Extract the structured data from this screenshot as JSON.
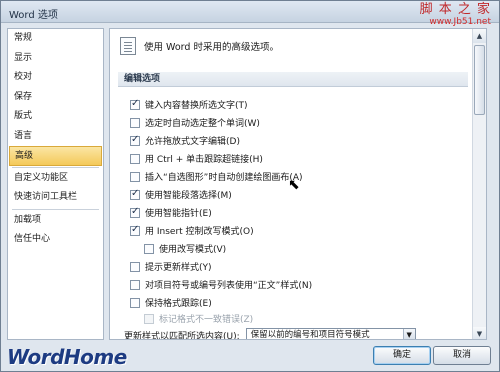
{
  "window": {
    "title": "Word 选项"
  },
  "titlebar": {
    "help_label": "?",
    "close_label": "✕"
  },
  "watermark": {
    "name": "脚 本 之 家",
    "url": "www.Jb51.net"
  },
  "sidebar": {
    "items": [
      {
        "label": "常规"
      },
      {
        "label": "显示"
      },
      {
        "label": "校对"
      },
      {
        "label": "保存"
      },
      {
        "label": "版式"
      },
      {
        "label": "语言"
      },
      {
        "label": "高级",
        "active": true
      },
      {
        "label": "自定义功能区"
      },
      {
        "label": "快速访问工具栏"
      },
      {
        "label": "加载项"
      },
      {
        "label": "信任中心"
      }
    ]
  },
  "main": {
    "header": "使用 Word 时采用的高级选项。",
    "section_title": "编辑选项",
    "options": [
      {
        "label": "键入内容替换所选文字(T)",
        "checked": true,
        "level": 0
      },
      {
        "label": "选定时自动选定整个单词(W)",
        "checked": false,
        "level": 0
      },
      {
        "label": "允许拖放式文字编辑(D)",
        "checked": true,
        "level": 0
      },
      {
        "label": "用 Ctrl + 单击跟踪超链接(H)",
        "checked": false,
        "level": 0
      },
      {
        "label": "插入“自选图形”时自动创建绘图画布(A)",
        "checked": false,
        "level": 0
      },
      {
        "label": "使用智能段落选择(M)",
        "checked": true,
        "level": 0
      },
      {
        "label": "使用智能指针(E)",
        "checked": true,
        "level": 0
      },
      {
        "label": "用 Insert 控制改写模式(O)",
        "checked": true,
        "level": 0
      },
      {
        "label": "使用改写模式(V)",
        "checked": false,
        "level": 1
      },
      {
        "label": "提示更新样式(Y)",
        "checked": false,
        "level": 0
      },
      {
        "label": "对项目符号或编号列表使用“正文”样式(N)",
        "checked": false,
        "level": 0
      },
      {
        "label": "保持格式跟踪(E)",
        "checked": false,
        "level": 0
      },
      {
        "label": "标记格式不一致错误(Z)",
        "checked": false,
        "level": 1,
        "disabled": true
      }
    ],
    "update_style_label": "更新样式以匹配所选内容(U):",
    "update_style_value": "保留以前的编号和项目符号模式"
  },
  "footer": {
    "brand": "WordHome",
    "ok_label": "确定",
    "cancel_label": "取消"
  }
}
